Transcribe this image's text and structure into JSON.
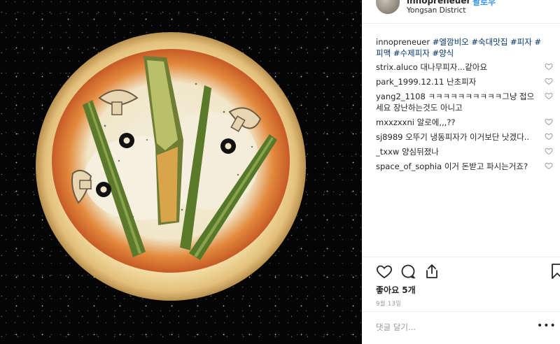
{
  "header": {
    "username": "innopreneuer",
    "follow_label": "팔로우",
    "location": "Yongsan District"
  },
  "caption": {
    "username": "innopreneuer",
    "hashtags": [
      "#엘깜비오",
      "#숙대맛집",
      "#피자",
      "#피맥",
      "#수제피자",
      "#양식"
    ]
  },
  "comments": [
    {
      "user": "strix.aluco",
      "text": "대나무피자...같아요"
    },
    {
      "user": "park_1999.12.11",
      "text": "난초피자"
    },
    {
      "user": "yang2_1108",
      "text": "ㅋㅋㅋㅋㅋㅋㅋㅋㅋㅋ그냥 접으세요 장난하는것도 아니고"
    },
    {
      "user": "mxxzxxni",
      "text": "알로에,,,??"
    },
    {
      "user": "sj8989",
      "text": "오뚜기 냉동피자가 이거보단 낫겠다.."
    },
    {
      "user": "_txxw",
      "text": "양심뒤졌나"
    },
    {
      "user": "space_of_sophia",
      "text": "이거 돈받고 파시는거죠?"
    }
  ],
  "likes_text": "좋아요 5개",
  "date_text": "9월 13일",
  "comment_placeholder": "댓글 달기...",
  "more_label": "•••",
  "icons": {
    "like": "heart-icon",
    "comment": "comment-bubble-icon",
    "share": "share-icon",
    "save": "bookmark-icon"
  },
  "colors": {
    "hashtag": "#003569",
    "follow": "#3897f0",
    "muted": "#999999",
    "divider": "#efefef"
  }
}
